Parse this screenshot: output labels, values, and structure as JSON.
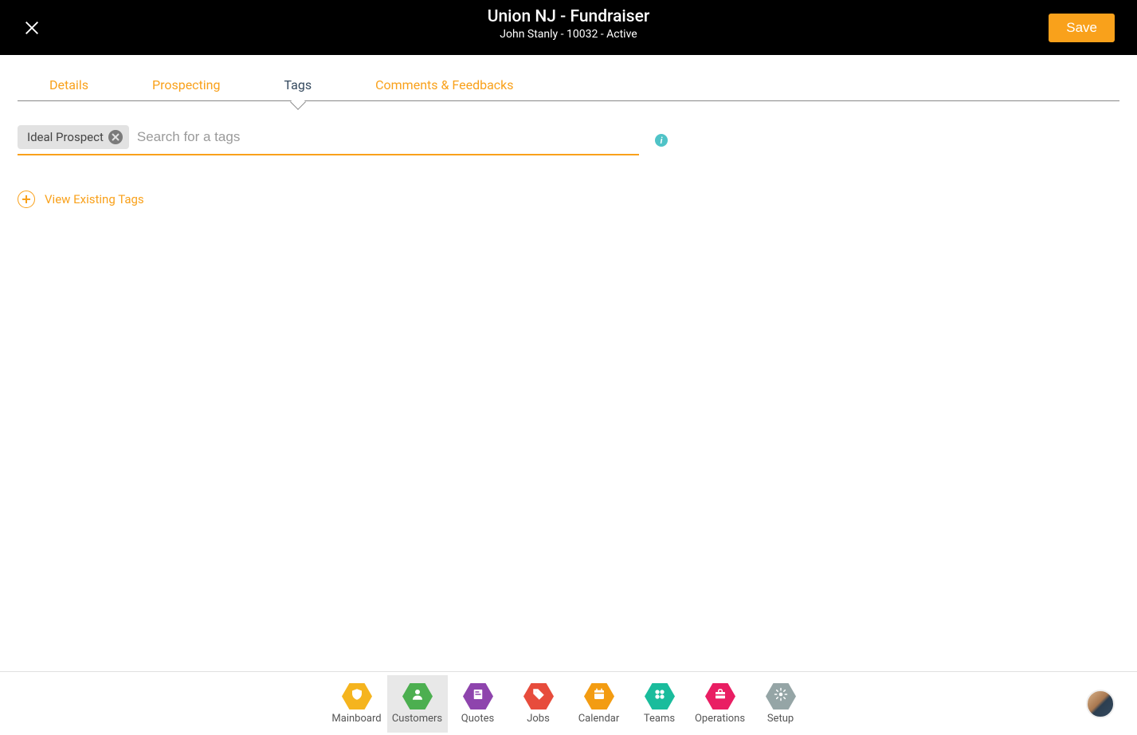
{
  "header": {
    "title": "Union NJ - Fundraiser",
    "subtitle": "John Stanly - 10032 - Active",
    "save_label": "Save"
  },
  "tabs": [
    {
      "id": "details",
      "label": "Details",
      "active": false
    },
    {
      "id": "prospecting",
      "label": "Prospecting",
      "active": false
    },
    {
      "id": "tags",
      "label": "Tags",
      "active": true
    },
    {
      "id": "comments",
      "label": "Comments & Feedbacks",
      "active": false
    }
  ],
  "tags_panel": {
    "chips": [
      {
        "label": "Ideal Prospect"
      }
    ],
    "search_placeholder": "Search for a tags",
    "view_existing_label": "View Existing Tags"
  },
  "bottom_nav": [
    {
      "id": "mainboard",
      "label": "Mainboard",
      "color": "#f5b41e",
      "active": false,
      "icon": "shield"
    },
    {
      "id": "customers",
      "label": "Customers",
      "color": "#4caf50",
      "active": true,
      "icon": "person"
    },
    {
      "id": "quotes",
      "label": "Quotes",
      "color": "#8e44ad",
      "active": false,
      "icon": "receipt"
    },
    {
      "id": "jobs",
      "label": "Jobs",
      "color": "#e74c3c",
      "active": false,
      "icon": "tag"
    },
    {
      "id": "calendar",
      "label": "Calendar",
      "color": "#f39c12",
      "active": false,
      "icon": "calendar"
    },
    {
      "id": "teams",
      "label": "Teams",
      "color": "#1abc9c",
      "active": false,
      "icon": "dots"
    },
    {
      "id": "operations",
      "label": "Operations",
      "color": "#e91e63",
      "active": false,
      "icon": "briefcase"
    },
    {
      "id": "setup",
      "label": "Setup",
      "color": "#95a5a6",
      "active": false,
      "icon": "gear"
    }
  ]
}
